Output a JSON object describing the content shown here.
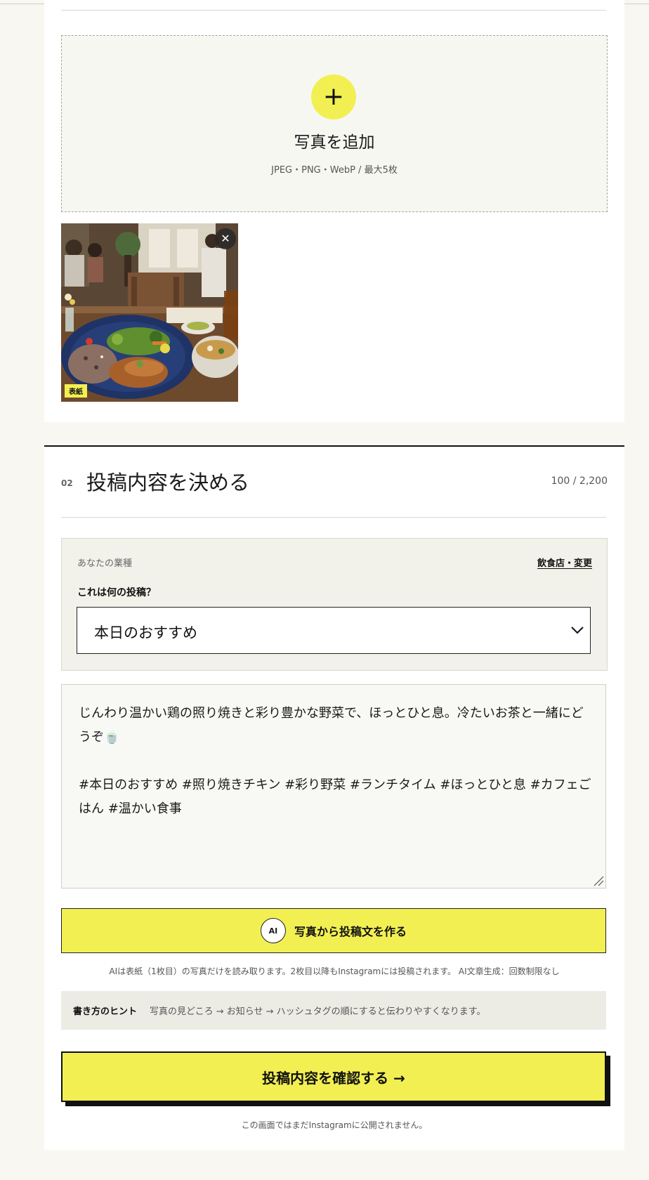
{
  "upload": {
    "plus_glyph": "+",
    "title": "写真を追加",
    "note": "JPEG・PNG・WebP / 最大5枚"
  },
  "photo": {
    "close_glyph": "✕",
    "cover_label": "表紙"
  },
  "section": {
    "number": "02",
    "title": "投稿内容を決める",
    "char_count": "100 / 2,200"
  },
  "industry": {
    "label": "あなたの業種",
    "change_link": "飲食店・変更",
    "question": "これは何の投稿？",
    "selected": "本日のおすすめ"
  },
  "post_text": "じんわり温かい鶏の照り焼きと彩り豊かな野菜で、ほっとひと息。冷たいお茶と一緒にどうぞ🍵\n\n#本日のおすすめ #照り焼きチキン #彩り野菜 #ランチタイム #ほっとひと息 #カフェごはん #温かい食事",
  "ai": {
    "badge": "AI",
    "button_label": "写真から投稿文を作る",
    "note": "AIは表紙（1枚目）の写真だけを読み取ります。2枚目以降もInstagramには投稿されます。 AI文章生成：回数制限なし"
  },
  "hint": {
    "title": "書き方のヒント",
    "text": "写真の見どころ → お知らせ → ハッシュタグの順にすると伝わりやすくなります。"
  },
  "confirm": {
    "label": "投稿内容を確認する →",
    "note": "この画面ではまだInstagramに公開されません。"
  },
  "colors": {
    "accent": "#f2ef53",
    "page_bg": "#f8f7f1",
    "panel_bg": "#f3f2ea"
  },
  "icons": {
    "add": "plus-icon",
    "remove": "close-icon",
    "dropdown": "chevron-down-icon",
    "resize": "resize-handle-icon"
  }
}
